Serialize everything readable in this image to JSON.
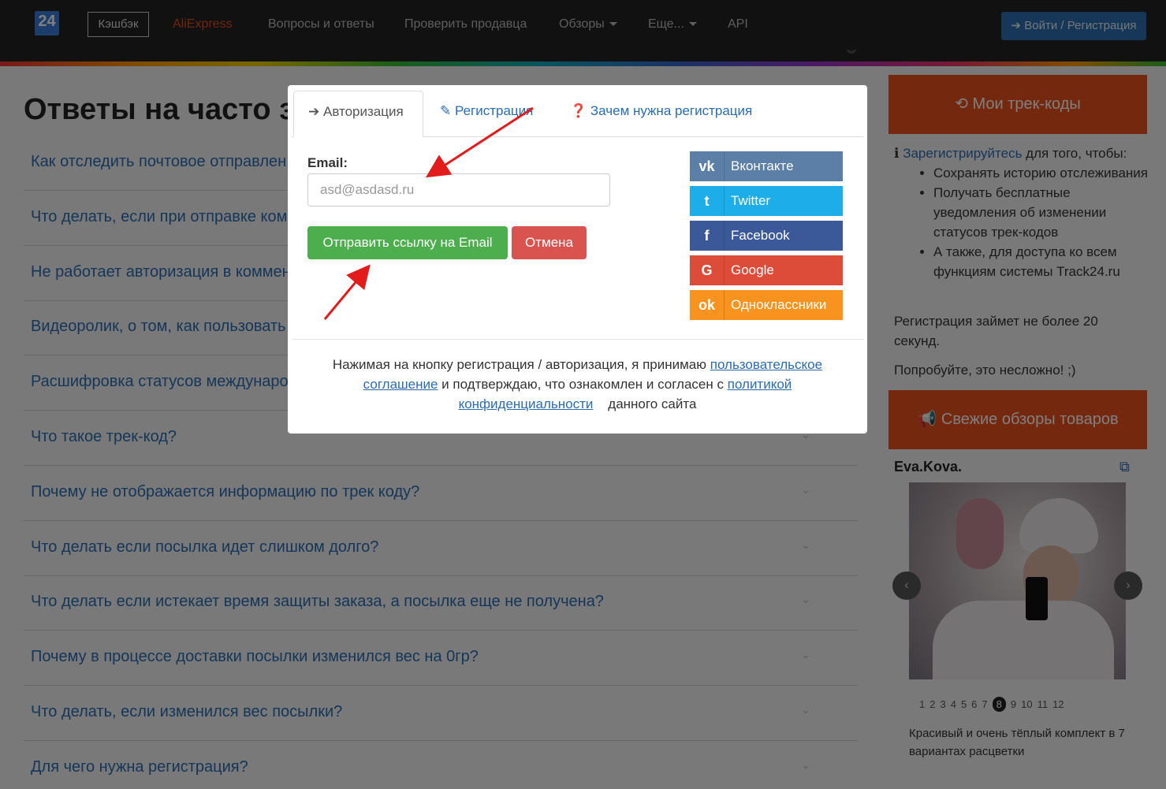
{
  "navbar": {
    "logo": "24",
    "cashback": "Кэшбэк",
    "aliexpress": "AliExpress",
    "faq": "Вопросы и ответы",
    "check_seller": "Проверить продавца",
    "reviews": "Обзоры",
    "more": "Еще...",
    "api": "API",
    "login": "Войти / Регистрация"
  },
  "page": {
    "title": "Ответы на часто за",
    "faq": [
      "Как отследить почтовое отправлен",
      "Что делать, если при отправке ком",
      "Не работает авторизация в коммен",
      "Видеоролик, о том, как пользовать",
      "Расшифровка статусов международ",
      "Что такое трек-код?",
      "Почему не отображается информацию по трек коду?",
      "Что делать если посылка идет слишком долго?",
      "Что делать если истекает время защиты заказа, а посылка еще не получена?",
      "Почему в процессе доставки посылки изменился вес на 0гр?",
      "Что делать, если изменился вес посылки?",
      "Для чего нужна регистрация?"
    ]
  },
  "sidebar": {
    "my_tracks": "Мои трек-коды",
    "register_link": "Зарегистрируйтесь",
    "register_rest": " для того, чтобы:",
    "benefits": [
      "Сохранять историю отслеживания",
      "Получать бесплатные уведомления об изменении статусов трек-кодов",
      "А также, для доступа ко всем функциям системы"
    ],
    "site_link": "Track24.ru",
    "time_note": "Регистрация займет не более 20 секунд.",
    "try_link": "Попробуйте",
    "try_rest": ", это несложно! ;)",
    "fresh_reviews": "Свежие обзоры товаров",
    "author": "Eva.Kova.",
    "pages": [
      "1",
      "2",
      "3",
      "4",
      "5",
      "6",
      "7",
      "8",
      "9",
      "10",
      "11",
      "12"
    ],
    "active_page": "8",
    "caption": "Красивый и очень тёплый комплект в 7 вариантах расцветки"
  },
  "modal": {
    "tabs": {
      "auth": "Авторизация",
      "register": "Регистрация",
      "why": "Зачем нужна регистрация"
    },
    "email_label": "Email:",
    "email_value": "asd@asdasd.ru",
    "send_button": "Отправить ссылку на Email",
    "cancel_button": "Отмена",
    "social": [
      {
        "label": "Вконтакте",
        "icon": "vk-icon",
        "glyph": "vk",
        "color": "#5b7fa6"
      },
      {
        "label": "Twitter",
        "icon": "twitter-icon",
        "glyph": "t",
        "color": "#1dade8"
      },
      {
        "label": "Facebook",
        "icon": "facebook-icon",
        "glyph": "f",
        "color": "#3b5998"
      },
      {
        "label": "Google",
        "icon": "google-icon",
        "glyph": "G",
        "color": "#dd4b39"
      },
      {
        "label": "Одноклассники",
        "icon": "odnoklassniki-icon",
        "glyph": "ok",
        "color": "#f7931e"
      }
    ],
    "footer": {
      "part1": "Нажимая на кнопку регистрация / авторизация, я принимаю ",
      "link1": "пользовательское соглашение",
      "part2": " и подтверждаю, что ознакомлен и согласен с ",
      "link2": "политикой конфиденциальности",
      "part3": "    данного сайта"
    }
  },
  "colors": {
    "accent_orange": "#e8531c",
    "link_blue": "#2b6cb0",
    "success_green": "#4cae4c",
    "danger_red": "#d9534f",
    "arrow_red": "#e21b1b"
  }
}
